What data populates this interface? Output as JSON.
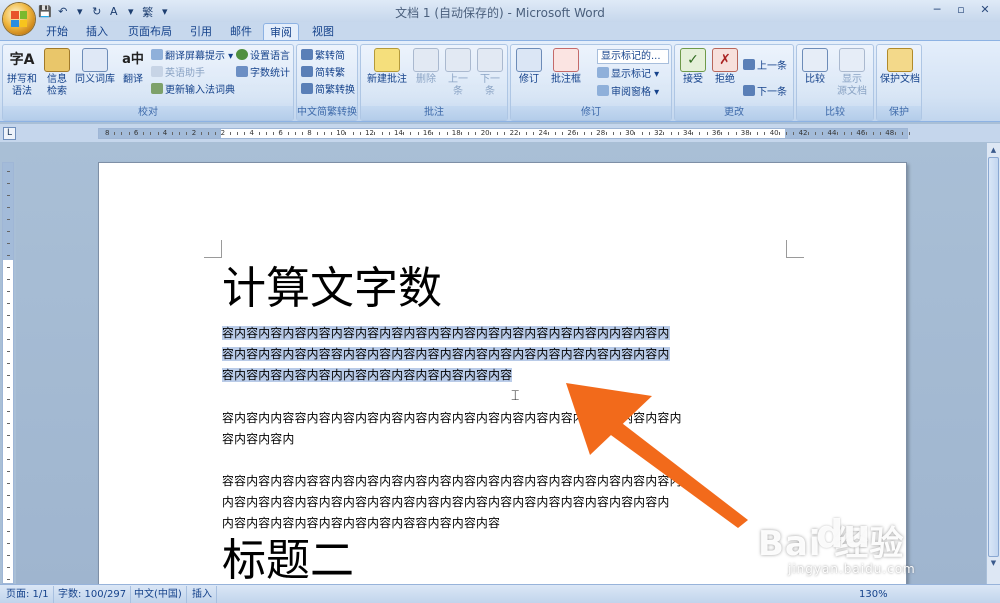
{
  "window": {
    "title": "文档 1 (自动保存的) - Microsoft Word",
    "controls": [
      "─",
      "▫",
      "✕"
    ]
  },
  "qat": {
    "items": [
      "💾",
      "↶",
      "▾",
      "↻",
      "A",
      "▾",
      "繁",
      "▾"
    ]
  },
  "tabs": [
    "开始",
    "插入",
    "页面布局",
    "引用",
    "邮件",
    "审阅",
    "视图"
  ],
  "active_tab": "审阅",
  "ribbon": {
    "proofing": {
      "label": "校对",
      "spell": "拼写和\n语法",
      "research": "信息\n检索",
      "thesaurus": "同义词库",
      "translate": "翻译",
      "translate_screentip": "翻译屏幕提示",
      "english_assistant": "英语助手",
      "update_ime": "更新输入法词典",
      "set_language": "设置语言",
      "word_count": "字数统计"
    },
    "chinese": {
      "label": "中文简繁转换",
      "trad_to_simp": "繁转简",
      "simp_to_trad": "简转繁",
      "convert": "简繁转换"
    },
    "comments": {
      "label": "批注",
      "new": "新建批注",
      "delete": "删除",
      "prev": "上一\n条",
      "next": "下一\n条"
    },
    "tracking": {
      "label": "修订",
      "track": "修订",
      "balloons": "批注框",
      "show_markup_final": "显示标记的...",
      "show_markup": "显示标记",
      "review_pane": "审阅窗格"
    },
    "changes": {
      "label": "更改",
      "accept": "接受",
      "reject": "拒绝",
      "prev": "上一条",
      "next": "下一条"
    },
    "compare": {
      "label": "比较",
      "compare": "比较",
      "show_source": "显示\n源文档"
    },
    "protect": {
      "label": "保护",
      "protect_doc": "保护文档"
    }
  },
  "ruler": {
    "corner": "L",
    "labels": [
      "8",
      "6",
      "4",
      "2",
      "2",
      "4",
      "6",
      "8",
      "10",
      "12",
      "14",
      "16",
      "18",
      "20",
      "22",
      "24",
      "26",
      "28",
      "30",
      "32",
      "34",
      "36",
      "38",
      "40",
      "42",
      "44",
      "46",
      "48"
    ]
  },
  "document": {
    "heading1": "计算文字数",
    "para1": [
      "容内容内容内容内容内容内容内容内容内容内容内容内容内容内容内容内内容内容内",
      "容内容内容内容内容容内容内容内容内容内容内容内容内容内容内容内容内容内容内",
      "容内容内容内容内容内内容内容内容内容内容内容内容"
    ],
    "para2": [
      "容内容内内容容内容内容内容内容内容内容内容内容内容内容内容内容内容内容内容内",
      "容内容内容内"
    ],
    "para3": [
      "容容内容内容内容容内容内容内容内容内容内容内容内容内容内容内容内容内容内容内",
      "内容内容内容内容内容内容内容内容内容内容内容内容内容内容内容内容内容内容内",
      "内容内容内容内容内容内容内容内容容内容内容内容"
    ],
    "heading2": "标题二"
  },
  "status": {
    "page": "页面: 1/1",
    "words": "字数: 100/297",
    "language": "中文(中国)",
    "mode": "插入",
    "zoom": "130%"
  },
  "watermark": {
    "text": "Bai  经验",
    "paw": "du",
    "url": "jingyan.baidu.com"
  },
  "colors": {
    "selection": "#b9cbe8",
    "arrow": "#f26a1b",
    "ribbon_text": "#15428b"
  }
}
